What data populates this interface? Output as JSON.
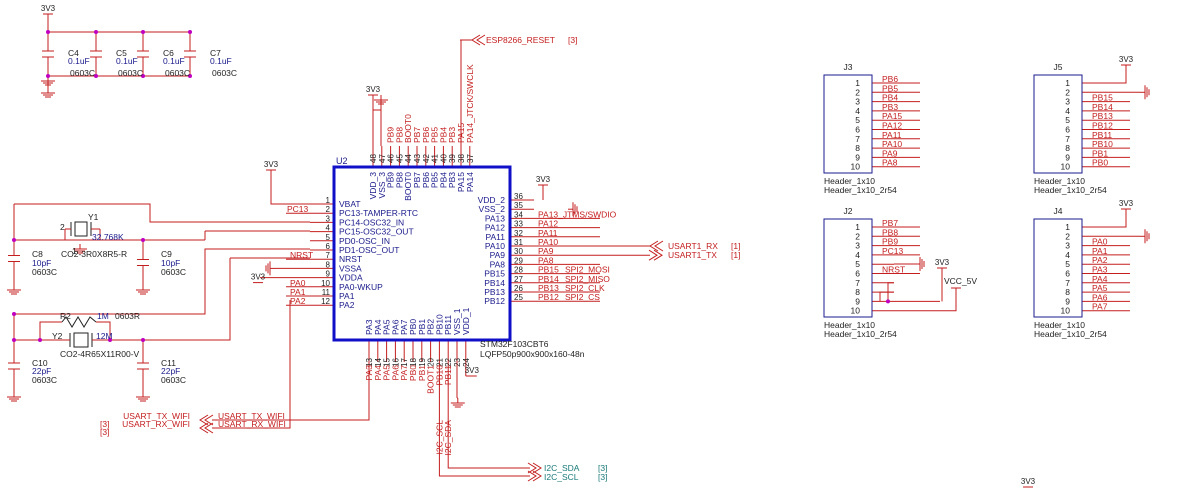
{
  "colors": {
    "wire": "#c41e1e",
    "chip": "#1010c8",
    "pin_text": "#1a1a8c",
    "net_text": "#c41e1e",
    "i2c_text": "#1a7a7a",
    "junction": "#c000c0"
  },
  "chip": {
    "ref": "U2",
    "part": "STM32F103CBT6",
    "footprint": "LQFP50p900x900x160-48n"
  },
  "left_pins": [
    {
      "num": "1",
      "name": "VBAT"
    },
    {
      "num": "2",
      "name": "PC13-TAMPER-RTC"
    },
    {
      "num": "3",
      "name": "PC14-OSC32_IN"
    },
    {
      "num": "4",
      "name": "PC15-OSC32_OUT"
    },
    {
      "num": "5",
      "name": "PD0-OSC_IN"
    },
    {
      "num": "6",
      "name": "PD1-OSC_OUT"
    },
    {
      "num": "7",
      "name": "NRST"
    },
    {
      "num": "8",
      "name": "VSSA"
    },
    {
      "num": "9",
      "name": "VDDA"
    },
    {
      "num": "10",
      "name": "PA0-WKUP"
    },
    {
      "num": "11",
      "name": "PA1"
    },
    {
      "num": "12",
      "name": "PA2"
    }
  ],
  "right_pins": [
    {
      "num": "36",
      "name": "VDD_2"
    },
    {
      "num": "35",
      "name": "VSS_2"
    },
    {
      "num": "34",
      "name": "PA13"
    },
    {
      "num": "33",
      "name": "PA12"
    },
    {
      "num": "32",
      "name": "PA11"
    },
    {
      "num": "31",
      "name": "PA10"
    },
    {
      "num": "30",
      "name": "PA9"
    },
    {
      "num": "29",
      "name": "PA8"
    },
    {
      "num": "28",
      "name": "PB15"
    },
    {
      "num": "27",
      "name": "PB14"
    },
    {
      "num": "26",
      "name": "PB13"
    },
    {
      "num": "25",
      "name": "PB12"
    }
  ],
  "top_pins": [
    {
      "num": "48",
      "name": "VDD_3"
    },
    {
      "num": "47",
      "name": "VSS_3"
    },
    {
      "num": "46",
      "name": "PB9"
    },
    {
      "num": "45",
      "name": "PB8"
    },
    {
      "num": "44",
      "name": "BOOT0"
    },
    {
      "num": "43",
      "name": "PB7"
    },
    {
      "num": "42",
      "name": "PB6"
    },
    {
      "num": "41",
      "name": "PB5"
    },
    {
      "num": "40",
      "name": "PB4"
    },
    {
      "num": "39",
      "name": "PB3"
    },
    {
      "num": "38",
      "name": "PA15"
    },
    {
      "num": "37",
      "name": "PA14"
    }
  ],
  "bottom_pins": [
    {
      "num": "13",
      "name": "PA3"
    },
    {
      "num": "14",
      "name": "PA4"
    },
    {
      "num": "15",
      "name": "PA5"
    },
    {
      "num": "16",
      "name": "PA6"
    },
    {
      "num": "17",
      "name": "PA7"
    },
    {
      "num": "18",
      "name": "PB0"
    },
    {
      "num": "19",
      "name": "PB1"
    },
    {
      "num": "20",
      "name": "PB2"
    },
    {
      "num": "21",
      "name": "PB10"
    },
    {
      "num": "22",
      "name": "PB11"
    },
    {
      "num": "23",
      "name": "VSS_1"
    },
    {
      "num": "24",
      "name": "VDD_1"
    }
  ],
  "top_nets": [
    "PB9",
    "PB8",
    "BOOT0",
    "PB7",
    "PB6",
    "PB5",
    "PB4",
    "PB3",
    "PA15",
    "PA14_JTCK/SWCLK"
  ],
  "bottom_nets": [
    "PA3",
    "PA4",
    "PA5",
    "PA6",
    "PA7",
    "PB0",
    "PB1",
    "BOOT1",
    "PB10",
    "PB11"
  ],
  "left_nets": {
    "pc13": "PC13",
    "nrst": "NRST",
    "pa0": "PA0",
    "pa1": "PA1",
    "pa2": "PA2"
  },
  "right_nets": [
    "PA13_JTMS/SWDIO",
    "PA12",
    "PA11",
    "PA10",
    "PA9",
    "PA8",
    "PB15",
    "PB14",
    "PB13",
    "PB12"
  ],
  "spi_labels": [
    "SPI2_MOSI",
    "SPI2_MISO",
    "SPI2_CLK",
    "SPI2_CS"
  ],
  "power": {
    "v3": "3V3",
    "vcc5": "VCC_5V"
  },
  "offpage": {
    "esp_reset": "ESP8266_RESET",
    "esp_ref": "[3]",
    "usart1_rx": "USART1_RX",
    "usart1_tx": "USART1_TX",
    "usart1_ref": "[1]",
    "usart_tx_wifi": "USART_TX_WIFI",
    "usart_rx_wifi": "USART_RX_WIFI",
    "wifi_ref": "[3]",
    "i2c_sda": "I2C_SDA",
    "i2c_scl": "I2C_SCL",
    "i2c_ref": "[3]",
    "i2c_scl_v": "I2C_SCL",
    "i2c_sda_v": "I2C_SDA"
  },
  "caps_top": [
    {
      "ref": "C4",
      "value": "0.1uF",
      "pkg": "0603C"
    },
    {
      "ref": "C5",
      "value": "0.1uF",
      "pkg": "0603C"
    },
    {
      "ref": "C6",
      "value": "0.1uF",
      "pkg": "0603C"
    },
    {
      "ref": "C7",
      "value": "0.1uF",
      "pkg": "0603C"
    }
  ],
  "osc": {
    "c8": {
      "ref": "C8",
      "value": "10pF",
      "pkg": "0603C"
    },
    "c9": {
      "ref": "C9",
      "value": "10pF",
      "pkg": "0603C"
    },
    "y1": {
      "ref": "Y1",
      "freq": "32.768K",
      "pkg": "CO2-3R0X8R5-R",
      "pin2": "2",
      "pin1": "1"
    },
    "c10": {
      "ref": "C10",
      "value": "22pF",
      "pkg": "0603C"
    },
    "c11": {
      "ref": "C11",
      "value": "22pF",
      "pkg": "0603C"
    },
    "y2": {
      "ref": "Y2",
      "freq": "12M",
      "pkg": "CO2-4R65X11R00-V"
    },
    "r2": {
      "ref": "R2",
      "value": "1M",
      "pkg": "0603R"
    }
  },
  "headers": [
    {
      "ref": "J3",
      "value": "Header_1x10",
      "pkg": "Header_1x10_2r54",
      "nets": [
        "PB6",
        "PB5",
        "PB4",
        "PB3",
        "PA15",
        "PA12",
        "PA11",
        "PA10",
        "PA9",
        "PA8"
      ]
    },
    {
      "ref": "J5",
      "value": "Header_1x10",
      "pkg": "Header_1x10_2r54",
      "nets": [
        "",
        "",
        "PB15",
        "PB14",
        "PB13",
        "PB12",
        "PB11",
        "PB10",
        "PB1",
        "PB0"
      ]
    },
    {
      "ref": "J2",
      "value": "Header_1x10",
      "pkg": "Header_1x10_2r54",
      "nets": [
        "PB7",
        "PB8",
        "PB9",
        "PC13",
        "",
        "NRST",
        "",
        "",
        "",
        ""
      ]
    },
    {
      "ref": "J4",
      "value": "Header_1x10",
      "pkg": "Header_1x10_2r54",
      "nets": [
        "",
        "",
        "PA0",
        "PA1",
        "PA2",
        "PA3",
        "PA4",
        "PA5",
        "PA6",
        "PA7"
      ]
    }
  ]
}
